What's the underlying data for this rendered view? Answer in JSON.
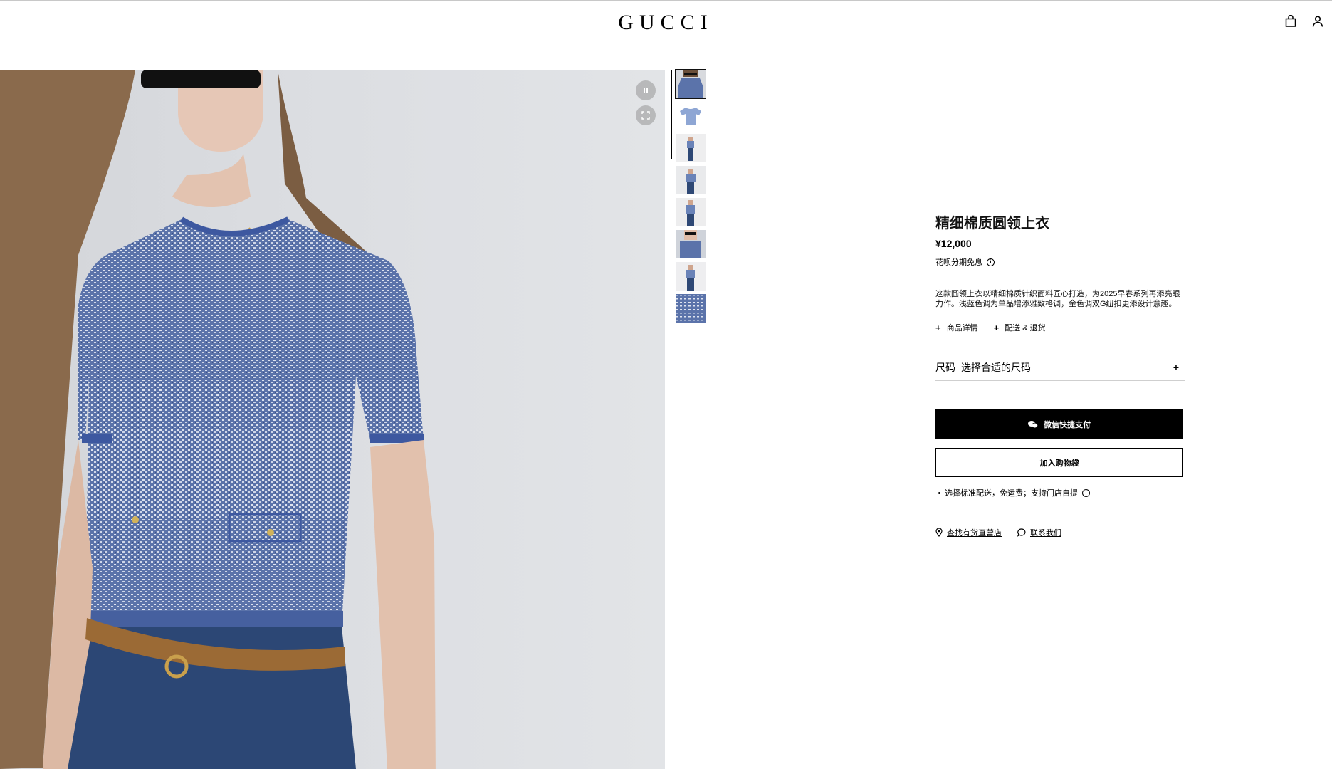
{
  "brand": {
    "logo": "GUCCI"
  },
  "header": {
    "icons": [
      "shopping-bag-icon",
      "account-icon"
    ]
  },
  "media": {
    "controls": [
      "pause-icon",
      "fullscreen-icon"
    ],
    "thumbnail_count": 8
  },
  "product": {
    "title": "精细棉质圆领上衣",
    "price": "¥12,000",
    "installment": "花呗分期免息",
    "description": "这款圆领上衣以精细棉质针织面料匠心打造，为2025早春系列再添亮眼力作。浅蓝色调为单品增添雅致格调，金色调双G纽扣更添设计意趣。",
    "links": {
      "details": "商品详情",
      "shipping": "配送 & 退货"
    },
    "size": {
      "label": "尺码",
      "prompt": "选择合适的尺码"
    },
    "buttons": {
      "wechat_pay": "微信快捷支付",
      "add_to_bag": "加入购物袋"
    },
    "shipping_note": "选择标准配送，免运费；支持门店自提",
    "store_links": {
      "find_store": "查找有货直营店",
      "contact": "联系我们"
    }
  },
  "colors": {
    "knit_blue": "#5a74ad",
    "denim": "#2a4470",
    "belt": "#9b6a35"
  }
}
